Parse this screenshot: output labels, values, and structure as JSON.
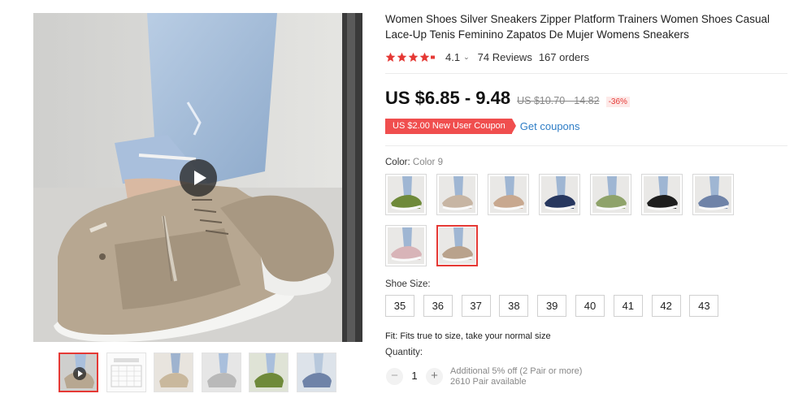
{
  "product": {
    "title": "Women Shoes Silver Sneakers Zipper Platform Trainers Women Shoes Casual Lace-Up Tenis Feminino Zapatos De Mujer Womens Sneakers"
  },
  "rating": {
    "value": "4.1",
    "reviews": "74 Reviews",
    "orders": "167 orders",
    "stars_filled": 4.1,
    "star_color": "#e53935"
  },
  "price": {
    "current": "US $6.85 - 9.48",
    "original": "US $10.70 - 14.82",
    "discount": "-36%"
  },
  "coupon": {
    "badge": "US $2.00 New User Coupon",
    "link": "Get coupons"
  },
  "color": {
    "label": "Color:",
    "selected": "Color 9",
    "options": [
      {
        "name": "Color 1",
        "shoe": "#6f8a3a"
      },
      {
        "name": "Color 2",
        "shoe": "#c7b5a3"
      },
      {
        "name": "Color 3",
        "shoe": "#c8a88f"
      },
      {
        "name": "Color 4",
        "shoe": "#27375f"
      },
      {
        "name": "Color 5",
        "shoe": "#8fa36a"
      },
      {
        "name": "Color 6",
        "shoe": "#1e1e1e"
      },
      {
        "name": "Color 7",
        "shoe": "#6f83a8"
      },
      {
        "name": "Color 8",
        "shoe": "#d8b4b8"
      },
      {
        "name": "Color 9",
        "shoe": "#b9a28c"
      }
    ],
    "selected_index": 8
  },
  "size": {
    "label": "Shoe Size:",
    "options": [
      "35",
      "36",
      "37",
      "38",
      "39",
      "40",
      "41",
      "42",
      "43"
    ]
  },
  "fit": "Fit: Fits true to size, take your normal size",
  "quantity": {
    "label": "Quantity:",
    "value": "1",
    "minus": "−",
    "plus": "+",
    "note_line1": "Additional 5% off (2 Pair or more)",
    "note_line2": "2610 Pair available"
  },
  "gallery": {
    "thumbnails": [
      "video",
      "size-chart",
      "beige",
      "grey",
      "green",
      "blue"
    ]
  },
  "colors": {
    "accent": "#e53935",
    "link": "#2e7dc6",
    "coupon_bg": "#f04e4e"
  }
}
